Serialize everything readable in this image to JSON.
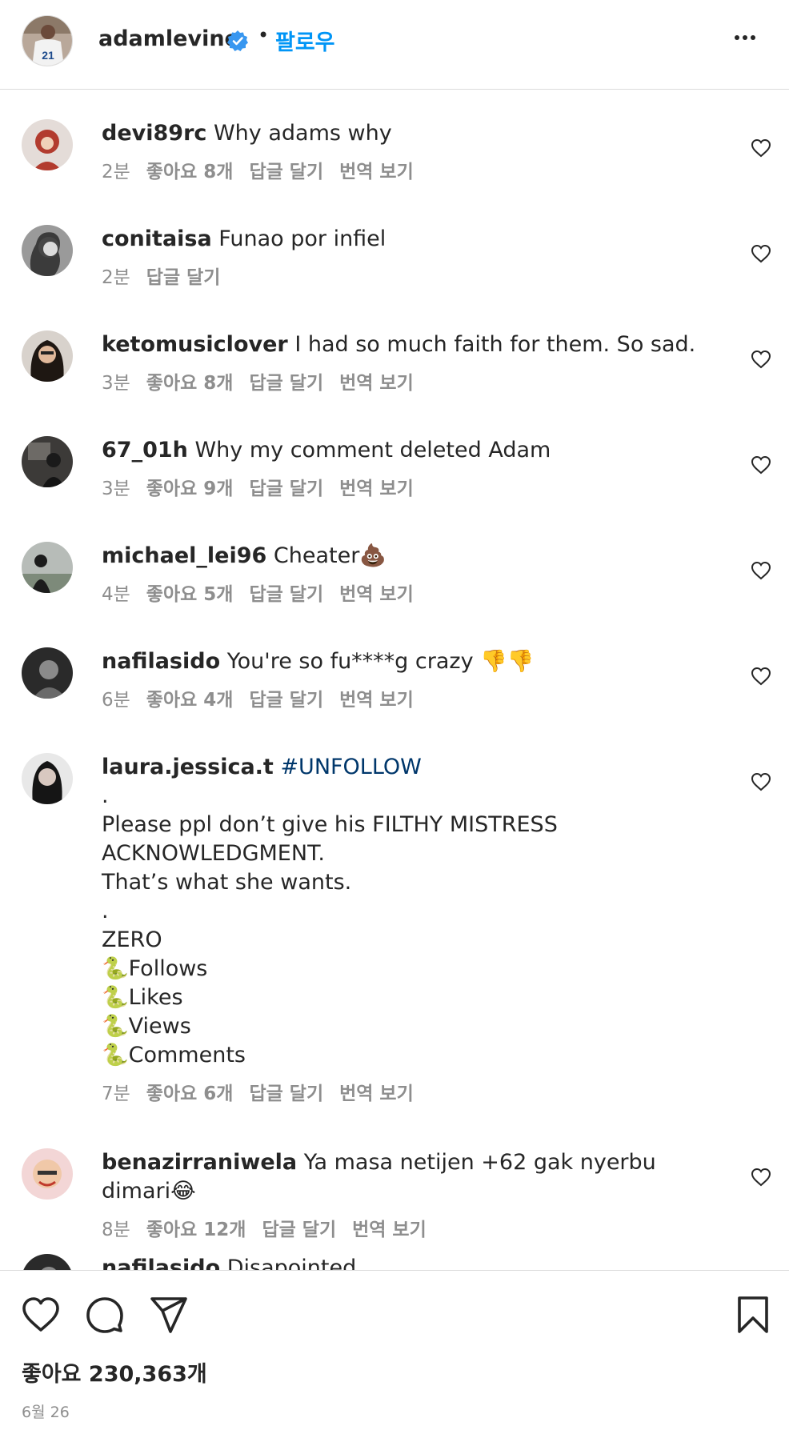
{
  "header": {
    "username": "adamlevine",
    "separator": "•",
    "follow_label": "팔로우"
  },
  "comments": [
    {
      "username": "devi89rc",
      "text": "Why adams why",
      "time": "2분",
      "likes": "좋아요 8개",
      "reply": "답글 달기",
      "translate": "번역 보기"
    },
    {
      "username": "conitaisa",
      "text": "Funao por infiel",
      "time": "2분",
      "likes": "",
      "reply": "답글 달기",
      "translate": ""
    },
    {
      "username": "ketomusiclover",
      "text": "I had so much faith for them. So sad.",
      "time": "3분",
      "likes": "좋아요 8개",
      "reply": "답글 달기",
      "translate": "번역 보기"
    },
    {
      "username": "67_01h",
      "text": "Why my comment deleted Adam",
      "time": "3분",
      "likes": "좋아요 9개",
      "reply": "답글 달기",
      "translate": "번역 보기"
    },
    {
      "username": "michael_lei96",
      "text": "Cheater💩",
      "time": "4분",
      "likes": "좋아요 5개",
      "reply": "답글 달기",
      "translate": "번역 보기"
    },
    {
      "username": "nafilasido",
      "text": "You're so fu****g crazy 👎👎",
      "time": "6분",
      "likes": "좋아요 4개",
      "reply": "답글 달기",
      "translate": "번역 보기"
    },
    {
      "username": "laura.jessica.t",
      "hashtag": "#UNFOLLOW",
      "lines": [
        ".",
        "Please ppl don’t give his FILTHY MISTRESS ACKNOWLEDGMENT.",
        "That’s what she wants.",
        ".",
        "ZERO",
        "🐍Follows",
        "🐍Likes",
        "🐍Views",
        "🐍Comments"
      ],
      "time": "7분",
      "likes": "좋아요 6개",
      "reply": "답글 달기",
      "translate": "번역 보기"
    },
    {
      "username": "benazirraniwela",
      "text": "Ya masa netijen +62 gak nyerbu dimari😂",
      "time": "8분",
      "likes": "좋아요 12개",
      "reply": "답글 달기",
      "translate": "번역 보기"
    },
    {
      "username": "nafilasido",
      "text": "Disapointed",
      "time": "",
      "likes": "",
      "reply": "",
      "translate": ""
    }
  ],
  "footer": {
    "likes": "좋아요 230,363개",
    "date": "6월 26"
  },
  "colors": {
    "accent": "#0095f6",
    "hashtag": "#00376b",
    "muted": "#8e8e8e",
    "text": "#262626"
  },
  "icons": [
    "verified-badge-icon",
    "more-options-icon",
    "heart-icon",
    "comment-icon",
    "share-icon",
    "bookmark-icon"
  ]
}
